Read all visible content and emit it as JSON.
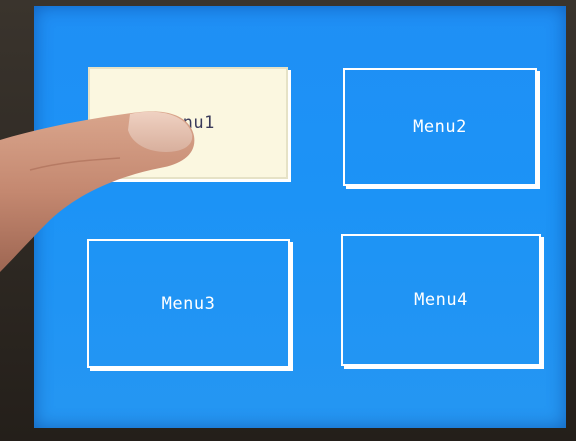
{
  "menu": {
    "items": [
      {
        "label": "Menu1",
        "state": "pressed"
      },
      {
        "label": "Menu2",
        "state": "normal"
      },
      {
        "label": "Menu3",
        "state": "normal"
      },
      {
        "label": "Menu4",
        "state": "normal"
      }
    ]
  },
  "colors": {
    "screen_bg": "#1f8ff5",
    "button_border": "#ffffff",
    "pressed_fill": "#fbf7e0"
  }
}
